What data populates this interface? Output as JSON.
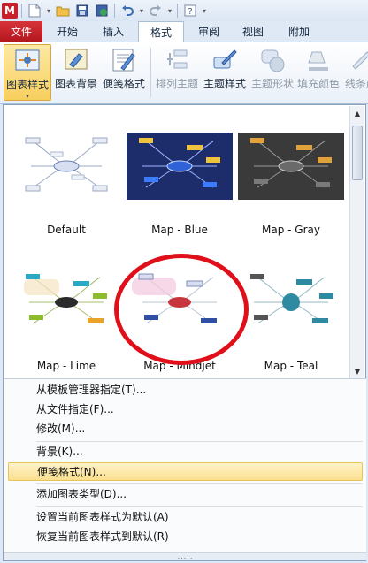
{
  "quick_access": {
    "app_icon": "M",
    "icons": [
      "new-file-icon",
      "open-folder-icon",
      "save-icon",
      "save-sync-icon",
      "undo-icon",
      "redo-icon",
      "help-icon"
    ]
  },
  "tabs": [
    {
      "label": "文件"
    },
    {
      "label": "开始"
    },
    {
      "label": "插入"
    },
    {
      "label": "格式",
      "active": true
    },
    {
      "label": "审阅"
    },
    {
      "label": "视图"
    },
    {
      "label": "附加"
    }
  ],
  "ribbon": {
    "buttons": [
      {
        "label": "图表样式",
        "icon": "chart-style-icon",
        "selected": true
      },
      {
        "label": "图表背景",
        "icon": "chart-background-icon"
      },
      {
        "label": "便笺格式",
        "icon": "note-format-icon"
      },
      {
        "label": "排列主题",
        "icon": "arrange-topics-icon",
        "disabled": true
      },
      {
        "label": "主题样式",
        "icon": "topic-style-icon"
      },
      {
        "label": "主题形状",
        "icon": "topic-shape-icon",
        "disabled": true
      },
      {
        "label": "填充颜色",
        "icon": "fill-color-icon",
        "disabled": true
      },
      {
        "label": "线条颜",
        "icon": "line-color-icon",
        "disabled": true
      }
    ]
  },
  "gallery": {
    "styles": [
      {
        "name": "Default",
        "bg": "#ffffff"
      },
      {
        "name": "Map - Blue",
        "bg": "#1d2d6b"
      },
      {
        "name": "Map - Gray",
        "bg": "#3a3a3a"
      },
      {
        "name": "Map - Lime",
        "bg": "#ffffff"
      },
      {
        "name": "Map - Mindjet",
        "bg": "#ffffff"
      },
      {
        "name": "Map - Teal",
        "bg": "#ffffff"
      }
    ],
    "highlight_color": "#e0101a"
  },
  "menu": {
    "items": [
      "从模板管理器指定(T)...",
      "从文件指定(F)...",
      "修改(M)...",
      "背景(K)...",
      "便笺格式(N)...",
      "添加图表类型(D)...",
      "设置当前图表样式为默认(A)",
      "恢复当前图表样式到默认(R)"
    ],
    "grip": "....."
  }
}
